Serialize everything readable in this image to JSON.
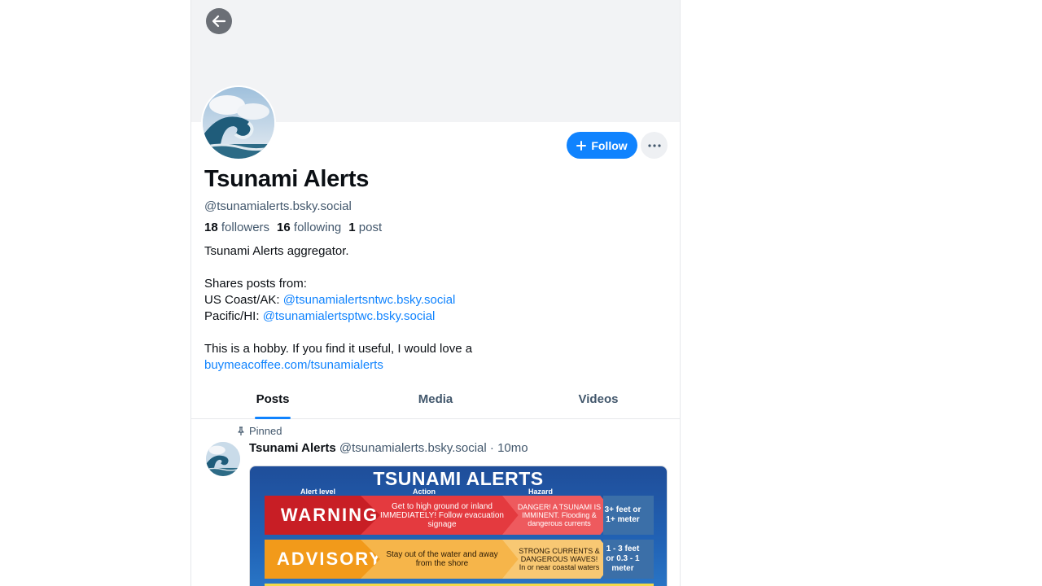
{
  "profile": {
    "name": "Tsunami Alerts",
    "handle": "@tsunamialerts.bsky.social",
    "followers_count": "18",
    "followers_label": "followers",
    "following_count": "16",
    "following_label": "following",
    "posts_count": "1",
    "posts_label": "post",
    "follow_label": "Follow"
  },
  "bio": {
    "line1": "Tsunami Alerts aggregator.",
    "line2": "Shares posts from:",
    "line3_prefix": "US Coast/AK: ",
    "line3_link": "@tsunamialertsntwc.bsky.social",
    "line4_prefix": "Pacific/HI: ",
    "line4_link": "@tsunamialertsptwc.bsky.social",
    "line5": "This is a hobby. If you find it useful, I would love a",
    "line6_link": "buymeacoffee.com/tsunamialerts"
  },
  "tabs": [
    {
      "label": "Posts",
      "active": true
    },
    {
      "label": "Media",
      "active": false
    },
    {
      "label": "Videos",
      "active": false
    }
  ],
  "post": {
    "pinned_label": "Pinned",
    "author": "Tsunami Alerts",
    "handle": "@tsunamialerts.bsky.social",
    "separator": "·",
    "age": "10mo",
    "image": {
      "title": "TSUNAMI ALERTS",
      "col_level": "Alert level",
      "col_action": "Action",
      "col_hazard": "Hazard",
      "rows": [
        {
          "level": "WARNING",
          "action": "Get to high ground or inland IMMEDIATELY! Follow evacuation signage",
          "hazard": "DANGER! A TSUNAMI IS IMMINENT. Flooding & dangerous currents",
          "height": "3+ feet or 1+ meter",
          "color": "#d7262b"
        },
        {
          "level": "ADVISORY",
          "action": "Stay out of the water and away from the shore",
          "hazard": "STRONG CURRENTS & DANGEROUS WAVES! In or near coastal waters",
          "height": "1 - 3 feet or 0.3 - 1 meter",
          "color": "#f4a21f"
        }
      ]
    }
  },
  "colors": {
    "accent": "#1083fe",
    "muted_text": "#42576c",
    "banner": "#f2f3f5"
  }
}
